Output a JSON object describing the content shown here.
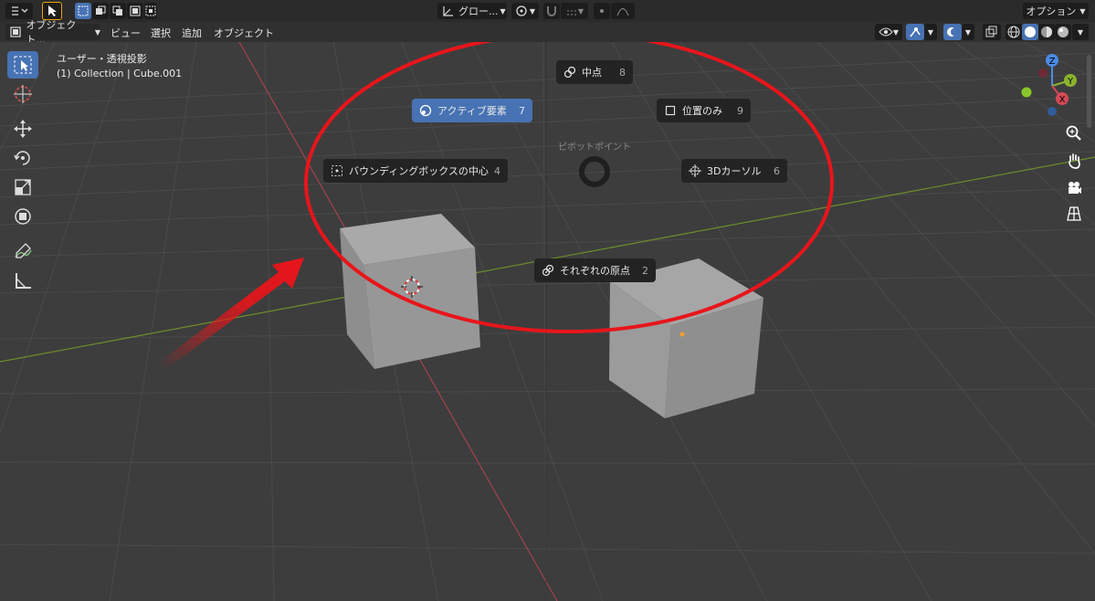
{
  "header": {
    "mode_label": "オブジェクト...",
    "menu": [
      "ビュー",
      "選択",
      "追加",
      "オブジェクト"
    ],
    "transform_orientation": "グロー...",
    "options_label": "オプション"
  },
  "overlay": {
    "view_name": "ユーザー・透視投影",
    "collection_info": "(1) Collection | Cube.001"
  },
  "pie_menu": {
    "title": "ピボットポイント",
    "items": [
      {
        "label": "中点",
        "key": "8"
      },
      {
        "label": "アクティブ要素",
        "key": "7"
      },
      {
        "label": "位置のみ",
        "key": "9"
      },
      {
        "label": "バウンディングボックスの中心",
        "key": "4"
      },
      {
        "label": "3Dカーソル",
        "key": "6"
      },
      {
        "label": "それぞれの原点",
        "key": "2"
      }
    ]
  },
  "gizmo": {
    "z": "Z",
    "y": "Y",
    "x": "X"
  },
  "colors": {
    "accent": "#4772b3",
    "annotation_red": "#e8151b",
    "x_axis": "#d44a56",
    "y_axis": "#8ab42e",
    "z_axis": "#4b8be6"
  }
}
